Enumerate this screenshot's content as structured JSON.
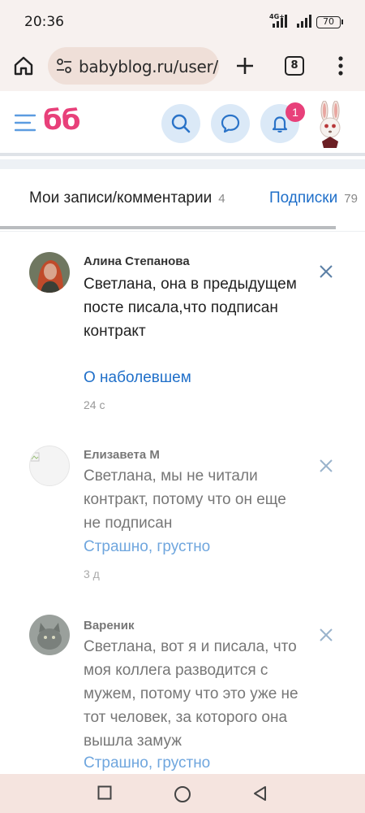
{
  "status": {
    "time": "20:36",
    "network": "4G+",
    "battery": "70"
  },
  "browser": {
    "url": "babyblog.ru/user/n",
    "tab_count": "8"
  },
  "site": {
    "logo": "бб",
    "notifications_count": "1"
  },
  "tabs": [
    {
      "label": "Мои записи/комментарии",
      "count": "4"
    },
    {
      "label": "Подписки",
      "count": "79"
    }
  ],
  "comments": [
    {
      "author": "Алина Степанова",
      "text": "Светлана, она в предыдущем посте писала,что подписан контракт",
      "post": "О наболевшем",
      "time": "24 с"
    },
    {
      "author": "Елизавета М",
      "text": "Светлана, мы не читали контракт, потому что он еще не подписан",
      "post": "Страшно, грустно",
      "time": "3 д"
    },
    {
      "author": "Вареник",
      "text": "Светлана, вот я и писала, что моя коллега разводится с мужем, потому что это уже не тот человек, за которого она вышла замуж",
      "post": "Страшно, грустно",
      "time": ""
    }
  ]
}
